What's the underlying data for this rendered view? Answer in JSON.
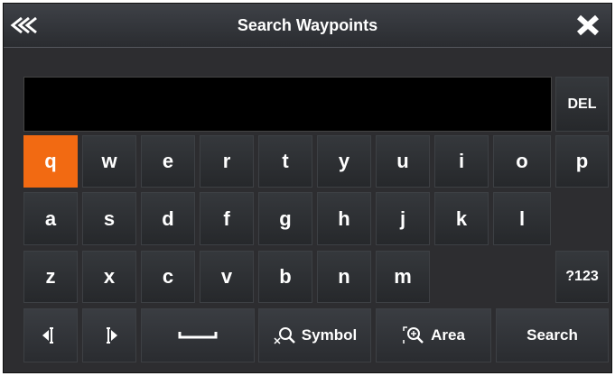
{
  "title": "Search Waypoints",
  "input_value": "",
  "keys": {
    "row1": [
      "q",
      "w",
      "e",
      "r",
      "t",
      "y",
      "u",
      "i",
      "o",
      "p"
    ],
    "row2": [
      "a",
      "s",
      "d",
      "f",
      "g",
      "h",
      "j",
      "k",
      "l"
    ],
    "row3": [
      "z",
      "x",
      "c",
      "v",
      "b",
      "n",
      "m"
    ],
    "del": "DEL",
    "num": "?123",
    "symbol": "Symbol",
    "area": "Area",
    "search": "Search"
  },
  "selected_key": "q",
  "colors": {
    "accent": "#f26a12",
    "background": "#2d2d30",
    "key": "#2f3135"
  }
}
